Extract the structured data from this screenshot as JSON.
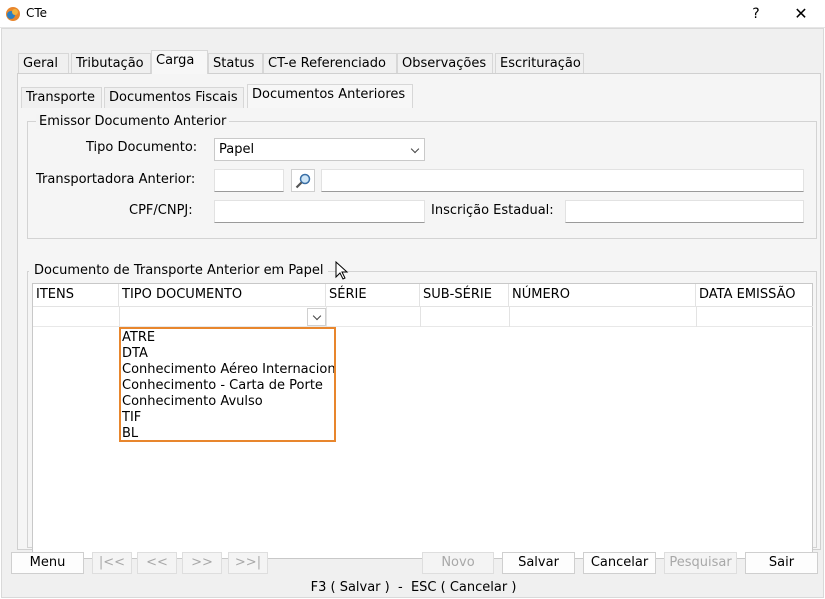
{
  "window": {
    "title": "CTe",
    "help_label": "?",
    "close_label": "✕"
  },
  "main_tabs": [
    "Geral",
    "Tributação",
    "Carga",
    "Status",
    "CT-e Referenciado",
    "Observações",
    "Escrituração"
  ],
  "sub_tabs": [
    "Transporte",
    "Documentos Fiscais",
    "Documentos Anteriores"
  ],
  "emissor": {
    "legend": "Emissor Documento Anterior",
    "tipo_documento_label": "Tipo Documento:",
    "tipo_documento_value": "Papel",
    "transportadora_label": "Transportadora Anterior:",
    "transportadora_code": "",
    "transportadora_name": "",
    "cpf_label": "CPF/CNPJ:",
    "cpf_value": "",
    "ie_label": "Inscrição Estadual:",
    "ie_value": ""
  },
  "papel": {
    "legend": "Documento de Transporte Anterior em Papel",
    "columns": [
      "ITENS",
      "TIPO DOCUMENTO",
      "SÉRIE",
      "SUB-SÉRIE",
      "NÚMERO",
      "DATA EMISSÃO"
    ],
    "dropdown_options": [
      "ATRE",
      "DTA",
      "Conhecimento Aéreo Internacional",
      "Conhecimento - Carta de Porte",
      "Conhecimento Avulso",
      "TIF",
      "BL"
    ]
  },
  "buttons": {
    "menu": "Menu",
    "first": "|<<",
    "prev": "<<",
    "next": ">>",
    "last": ">>|",
    "novo": "Novo",
    "salvar": "Salvar",
    "cancelar": "Cancelar",
    "pesquisar": "Pesquisar",
    "sair": "Sair"
  },
  "status_bar": "F3 ( Salvar )  -  ESC ( Cancelar )",
  "colors": {
    "accent_border": "#e8862d"
  }
}
